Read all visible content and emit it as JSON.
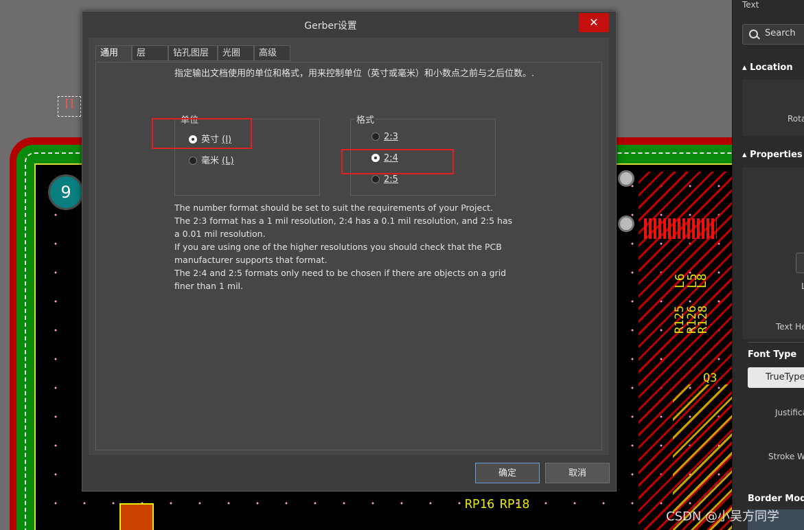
{
  "dialog": {
    "title": "Gerber设置",
    "close_symbol": "✕",
    "tabs": [
      "通用",
      "层",
      "钻孔图层",
      "光圈",
      "高级"
    ],
    "active_tab": "通用",
    "description": "指定输出文档使用的单位和格式，用来控制单位（英寸或毫米）和小数点之前与之后位数。.",
    "units_group": {
      "title": "单位",
      "options": [
        {
          "label": "英寸 (I)",
          "text": "英寸 ",
          "hotkey": "(I)",
          "selected": true
        },
        {
          "label": "毫米 (L)",
          "text": "毫米 ",
          "hotkey": "(L)",
          "selected": false
        }
      ]
    },
    "format_group": {
      "title": "格式",
      "options": [
        {
          "label": "2:3",
          "selected": false
        },
        {
          "label": "2:4",
          "selected": true
        },
        {
          "label": "2:5",
          "selected": false
        }
      ]
    },
    "info_lines": [
      "The number format should be set to suit the requirements of your Project.",
      "The 2:3 format has a 1 mil resolution, 2:4 has a 0.1 mil resolution, and 2:5 has a 0.01 mil resolution.",
      "If you are using one of the higher resolutions you should check that the PCB manufacturer supports that format.",
      "The 2:4 and 2:5 formats only need to be chosen if there are objects on a grid finer than 1 mil."
    ],
    "ok_label": "确定",
    "cancel_label": "取消"
  },
  "pcb": {
    "pad_number": "9",
    "silk_labels": [
      "L6",
      "L5",
      "L8",
      "R125",
      "R126",
      "R128",
      "Q3",
      "RP16",
      "RP18"
    ]
  },
  "panel": {
    "text_label": "Text",
    "search_placeholder": "Search",
    "location_header": "Location",
    "rotation_label": "Rota",
    "properties_header": "Properties",
    "l_label": "L",
    "text_height_label": "Text He",
    "font_type_header": "Font Type",
    "font_type_button": "TrueType",
    "justification_label": "Justifica",
    "stroke_width_label": "Stroke W",
    "border_mode_header": "Border Mode"
  },
  "watermark": "CSDN @小吴方同学",
  "colors": {
    "close_button": "#c40f0f",
    "highlight_box": "#e02020",
    "ok_border": "#6e9bd1"
  }
}
